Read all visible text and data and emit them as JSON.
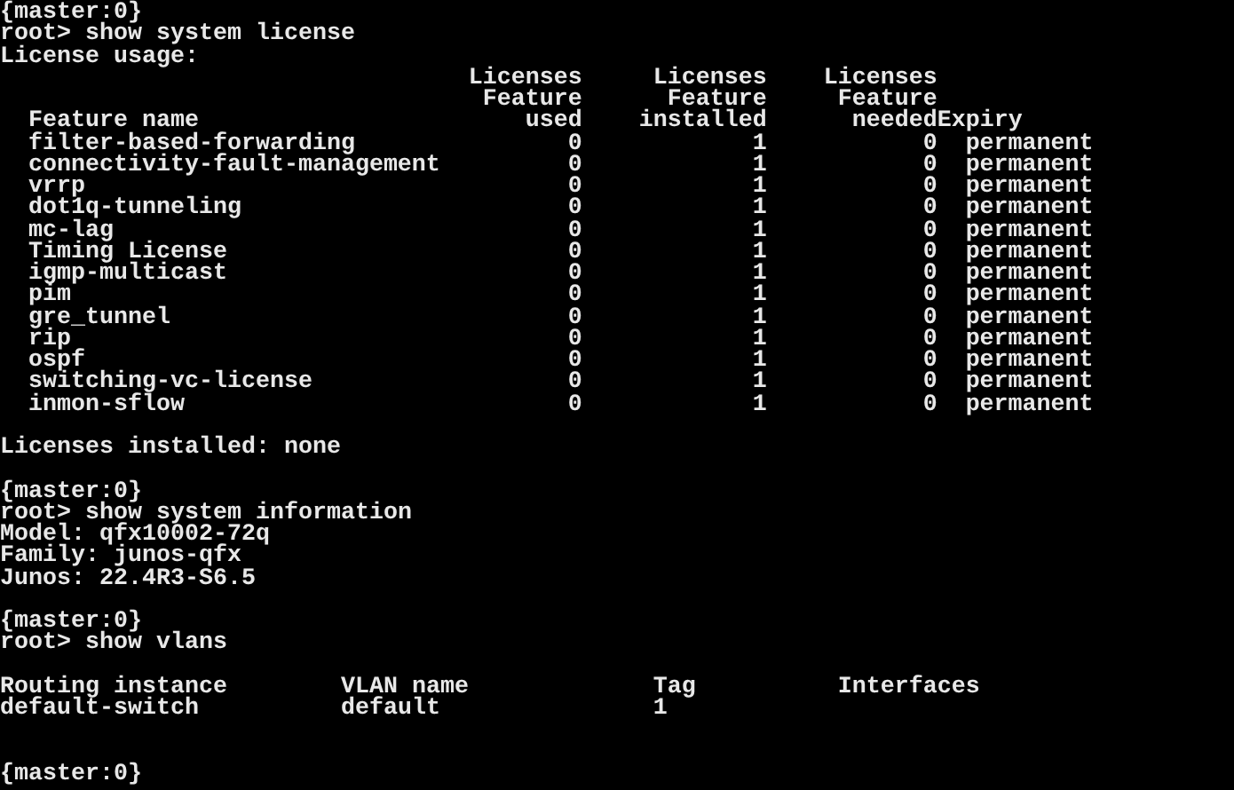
{
  "terminal": {
    "blocks": [
      {
        "kind": "line",
        "text": "{master:0}"
      },
      {
        "kind": "line",
        "text": "root> show system license"
      },
      {
        "kind": "line",
        "text": "License usage:"
      },
      {
        "kind": "license_table",
        "columns": [
          {
            "heading": [
              "Feature name"
            ]
          },
          {
            "heading": [
              "Licenses",
              "Feature",
              "used"
            ]
          },
          {
            "heading": [
              "Licenses",
              "Feature",
              "installed"
            ]
          },
          {
            "heading": [
              "Licenses",
              "Feature",
              "needed"
            ]
          },
          {
            "heading": [
              "Expiry"
            ]
          }
        ],
        "rows": [
          {
            "cells": [
              "filter-based-forwarding",
              "0",
              "1",
              "0",
              "permanent"
            ]
          },
          {
            "cells": [
              "connectivity-fault-management",
              "0",
              "1",
              "0",
              "permanent"
            ]
          },
          {
            "cells": [
              "vrrp",
              "0",
              "1",
              "0",
              "permanent"
            ]
          },
          {
            "cells": [
              "dot1q-tunneling",
              "0",
              "1",
              "0",
              "permanent"
            ]
          },
          {
            "cells": [
              "mc-lag",
              "0",
              "1",
              "0",
              "permanent"
            ]
          },
          {
            "cells": [
              "Timing License",
              "0",
              "1",
              "0",
              "permanent"
            ]
          },
          {
            "cells": [
              "igmp-multicast",
              "0",
              "1",
              "0",
              "permanent"
            ]
          },
          {
            "cells": [
              "pim",
              "0",
              "1",
              "0",
              "permanent"
            ]
          },
          {
            "cells": [
              "gre_tunnel",
              "0",
              "1",
              "0",
              "permanent"
            ]
          },
          {
            "cells": [
              "rip",
              "0",
              "1",
              "0",
              "permanent"
            ]
          },
          {
            "cells": [
              "ospf",
              "0",
              "1",
              "0",
              "permanent"
            ]
          },
          {
            "cells": [
              "switching-vc-license",
              "0",
              "1",
              "0",
              "permanent"
            ]
          },
          {
            "cells": [
              "inmon-sflow",
              "0",
              "1",
              "0",
              "permanent"
            ]
          }
        ]
      },
      {
        "kind": "blank"
      },
      {
        "kind": "line",
        "text": "Licenses installed: none"
      },
      {
        "kind": "blank"
      },
      {
        "kind": "line",
        "text": "{master:0}"
      },
      {
        "kind": "line",
        "text": "root> show system information"
      },
      {
        "kind": "line",
        "text": "Model: qfx10002-72q"
      },
      {
        "kind": "line",
        "text": "Family: junos-qfx"
      },
      {
        "kind": "line",
        "text": "Junos: 22.4R3-S6.5"
      },
      {
        "kind": "blank"
      },
      {
        "kind": "line",
        "text": "{master:0}"
      },
      {
        "kind": "line",
        "text": "root> show vlans"
      },
      {
        "kind": "blank"
      },
      {
        "kind": "vlan_table",
        "columns": [
          "Routing instance",
          "VLAN name",
          "Tag",
          "Interfaces"
        ],
        "rows": [
          {
            "cells": [
              "default-switch",
              "default",
              "1"
            ]
          }
        ]
      },
      {
        "kind": "blank"
      },
      {
        "kind": "blank"
      },
      {
        "kind": "line",
        "text": "{master:0}"
      }
    ]
  }
}
